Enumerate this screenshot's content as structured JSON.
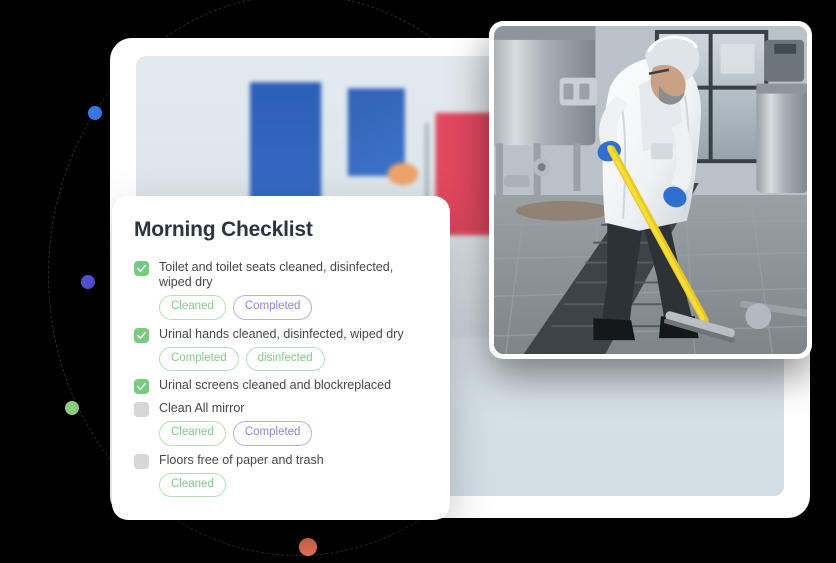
{
  "decor": {
    "ring_label": "dashed-orbit-ring",
    "dots": [
      {
        "name": "blue-dot",
        "color": "#3b82f6"
      },
      {
        "name": "purple-dot",
        "color": "#5b55e0"
      },
      {
        "name": "green-dot",
        "color": "#8ed17f"
      },
      {
        "name": "orange-dot",
        "color": "#f4795e"
      }
    ]
  },
  "background_card": {
    "photo_alt": "Cleaner in blue uniform with orange gloves mopping near a red cleaning cart"
  },
  "photo_card": {
    "photo_alt": "Worker in white protective coverall and hairnet using a yellow squeegee to clean the floor of an industrial facility with stainless steel tanks"
  },
  "checklist": {
    "title": "Morning Checklist",
    "items": [
      {
        "label": "Toilet and toilet seats cleaned, disinfected, wiped dry",
        "checked": true,
        "badges": [
          {
            "text": "Cleaned",
            "tone": "green"
          },
          {
            "text": "Completed",
            "tone": "purple"
          }
        ]
      },
      {
        "label": "Urinal hands cleaned, disinfected, wiped dry",
        "checked": true,
        "badges": [
          {
            "text": "Completed",
            "tone": "green"
          },
          {
            "text": "disinfected",
            "tone": "green"
          }
        ]
      },
      {
        "label": "Urinal screens cleaned and blockreplaced",
        "checked": true,
        "badges": []
      },
      {
        "label": "Clean All mirror",
        "checked": false,
        "badges": [
          {
            "text": "Cleaned",
            "tone": "green"
          },
          {
            "text": "Completed",
            "tone": "purple"
          }
        ]
      },
      {
        "label": "Floors free of paper and trash",
        "checked": false,
        "badges": [
          {
            "text": "Cleaned",
            "tone": "green"
          }
        ]
      }
    ]
  },
  "colors": {
    "checked_box": "#77cb7e",
    "unchecked_box": "#d7d7d7",
    "badge_green_text": "#86c98b",
    "badge_purple_text": "#8b85d9",
    "title_text": "#2b3440",
    "canvas": "#000000"
  }
}
